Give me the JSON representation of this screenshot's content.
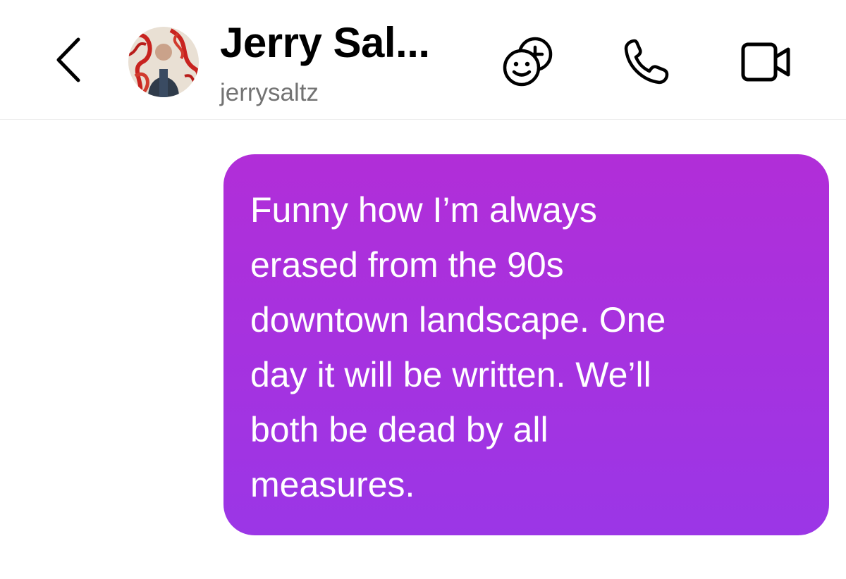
{
  "header": {
    "contact_name": "Jerry Sal...",
    "contact_username": "jerrysaltz",
    "icons": {
      "back": "chevron-left-icon",
      "effects": "add-effect-icon",
      "call": "phone-icon",
      "video": "video-camera-icon"
    }
  },
  "conversation": {
    "messages": [
      {
        "direction": "outgoing",
        "text": "Funny how I’m always\nerased from the 90s\ndowntown landscape. One\nday it will be written. We’ll\nboth be dead by all\nmeasures."
      }
    ]
  },
  "colors": {
    "bubble_gradient_top": "#b12ed8",
    "bubble_gradient_bottom": "#9b36e6",
    "text_primary": "#000000",
    "text_secondary": "#737373",
    "background": "#ffffff"
  }
}
